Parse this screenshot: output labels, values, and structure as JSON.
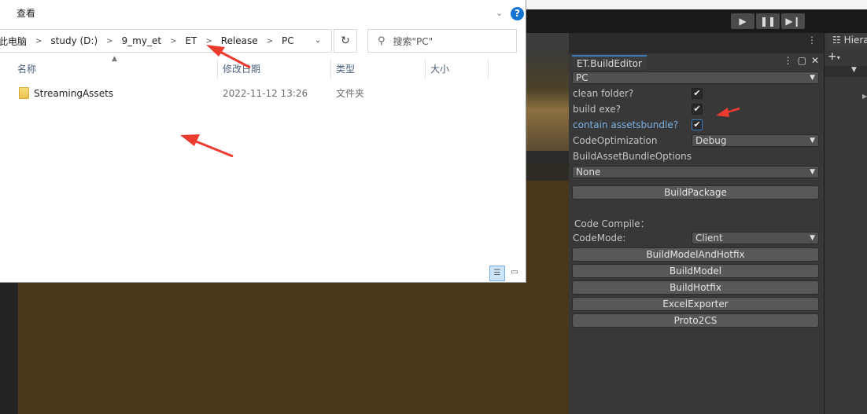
{
  "explorer": {
    "menu_view": "查看",
    "breadcrumb": [
      "此电脑",
      "study (D:)",
      "9_my_et",
      "ET",
      "Release",
      "PC"
    ],
    "search_placeholder": "搜索\"PC\"",
    "columns": {
      "name": "名称",
      "modified": "修改日期",
      "type": "类型",
      "size": "大小"
    },
    "rows": [
      {
        "name": "StreamingAssets",
        "modified": "2022-11-12 13:26",
        "type": "文件夹",
        "size": ""
      }
    ],
    "help_label": "?"
  },
  "unity": {
    "hierarchy_tab": "Hierarchy",
    "build_editor": {
      "tab_title": "ET.BuildEditor",
      "platform": "PC",
      "clean_folder_label": "clean folder?",
      "clean_folder_checked": true,
      "build_exe_label": "build exe?",
      "build_exe_checked": true,
      "contain_assetsbundle_label": "contain assetsbundle?",
      "contain_assetsbundle_checked": true,
      "code_optimization_label": "CodeOptimization",
      "code_optimization_value": "Debug",
      "bundle_options_label": "BuildAssetBundleOptions",
      "bundle_options_value": "None",
      "build_package_button": "BuildPackage",
      "code_compile_label": "Code Compile：",
      "code_mode_label": "CodeMode:",
      "code_mode_value": "Client",
      "buttons": [
        "BuildModelAndHotfix",
        "BuildModel",
        "BuildHotfix",
        "ExcelExporter",
        "Proto2CS"
      ]
    }
  },
  "colors": {
    "annotation_arrow": "#ee3b30",
    "tab_accent": "#3a79bb",
    "scene_ground": "#4a3619"
  }
}
